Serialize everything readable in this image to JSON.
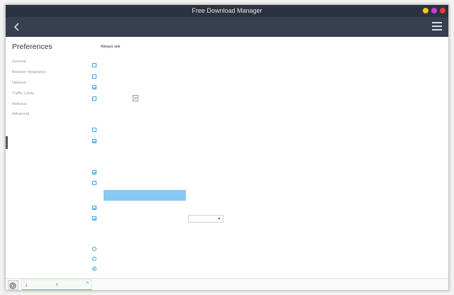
{
  "window": {
    "title": "Free Download Manager",
    "wm_colors": [
      "#f5c518",
      "#c93ddb",
      "#e83a3a"
    ]
  },
  "toolbar": {
    "back_icon": "chevron-left-icon",
    "menu_icon": "hamburger-menu-icon"
  },
  "sidebar": {
    "title": "Preferences",
    "items": [
      {
        "label": "General"
      },
      {
        "label": "Browser Integration"
      },
      {
        "label": "Network"
      },
      {
        "label": "Traffic Limits"
      },
      {
        "label": "Antivirus"
      },
      {
        "label": "Advanced"
      }
    ]
  },
  "content": {
    "top_value": "Always ask",
    "checkboxes": [
      {
        "checked": false
      },
      {
        "checked": false
      },
      {
        "checked": true
      },
      {
        "checked": false
      },
      {
        "checked": false
      },
      {
        "checked": true
      },
      {
        "checked": true
      },
      {
        "checked": false
      },
      {
        "checked": true
      },
      {
        "checked": true
      }
    ],
    "radios": [
      {
        "checked": false
      },
      {
        "checked": false
      },
      {
        "checked": true
      }
    ],
    "accent_color": "#38a6e6"
  },
  "statusbar": {
    "snail_icon": "snail-icon",
    "download_icon": "↓",
    "upload_icon": "↑",
    "expand_icon": "^",
    "speed_color": "#79c251"
  }
}
